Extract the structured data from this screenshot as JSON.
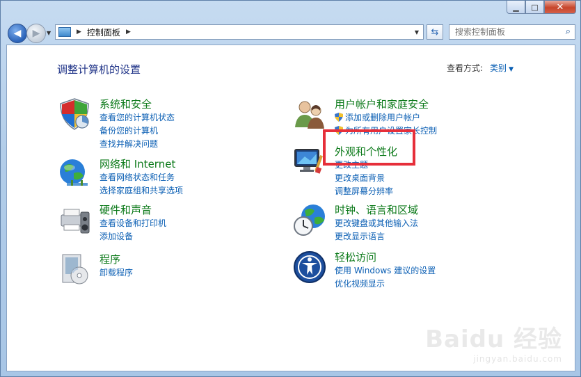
{
  "window": {
    "min_label": "▁",
    "max_label": "□",
    "close_label": "✕"
  },
  "toolbar": {
    "address": "控制面板",
    "search_placeholder": "搜索控制面板"
  },
  "header": {
    "title": "调整计算机的设置",
    "view_by_label": "查看方式:",
    "view_by_value": "类别"
  },
  "categories": [
    {
      "heading": "系统和安全",
      "links": [
        "查看您的计算机状态",
        "备份您的计算机",
        "查找并解决问题"
      ]
    },
    {
      "heading": "网络和 Internet",
      "links": [
        "查看网络状态和任务",
        "选择家庭组和共享选项"
      ]
    },
    {
      "heading": "硬件和声音",
      "links": [
        "查看设备和打印机",
        "添加设备"
      ]
    },
    {
      "heading": "程序",
      "links": [
        "卸载程序"
      ]
    },
    {
      "heading": "用户帐户和家庭安全",
      "links": [
        "添加或删除用户帐户",
        "为所有用户设置家长控制"
      ]
    },
    {
      "heading": "外观和个性化",
      "links": [
        "更改主题",
        "更改桌面背景",
        "调整屏幕分辨率"
      ]
    },
    {
      "heading": "时钟、语言和区域",
      "links": [
        "更改键盘或其他输入法",
        "更改显示语言"
      ]
    },
    {
      "heading": "轻松访问",
      "links": [
        "使用 Windows 建议的设置",
        "优化视频显示"
      ]
    }
  ],
  "colors": {
    "heading": "#0c7a1a",
    "link": "#0b5fb4",
    "title": "#1e3287",
    "highlight": "#e62f3a"
  },
  "watermark": {
    "line1": "Baidu 经验",
    "line2": "jingyan.baidu.com"
  }
}
